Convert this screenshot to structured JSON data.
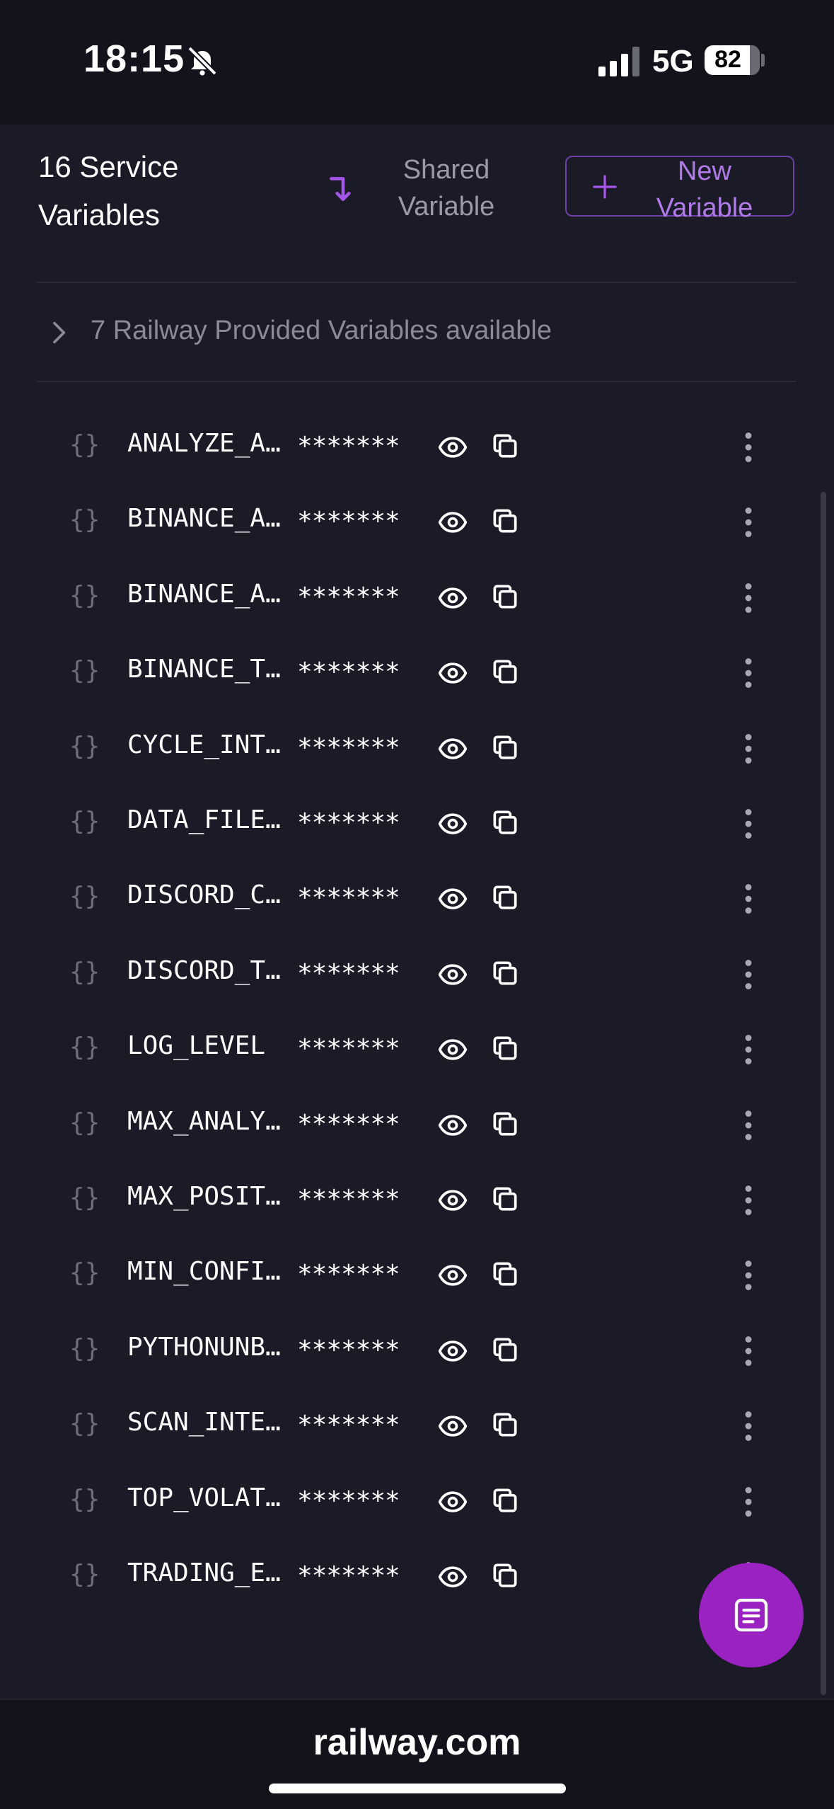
{
  "status_bar": {
    "time": "18:15",
    "network": "5G",
    "battery": "82"
  },
  "header": {
    "title_line1": "16 Service",
    "title_line2": "Variables",
    "shared_line1": "Shared",
    "shared_line2": "Variable",
    "new_line1": "New",
    "new_line2": "Variable"
  },
  "provided": {
    "text": "7 Railway Provided Variables available"
  },
  "variables": [
    {
      "name": "ANALYZE_A…",
      "value": "*******"
    },
    {
      "name": "BINANCE_A…",
      "value": "*******"
    },
    {
      "name": "BINANCE_A…",
      "value": "*******"
    },
    {
      "name": "BINANCE_T…",
      "value": "*******"
    },
    {
      "name": "CYCLE_INT…",
      "value": "*******"
    },
    {
      "name": "DATA_FILE…",
      "value": "*******"
    },
    {
      "name": "DISCORD_C…",
      "value": "*******"
    },
    {
      "name": "DISCORD_T…",
      "value": "*******"
    },
    {
      "name": "LOG_LEVEL",
      "value": "*******"
    },
    {
      "name": "MAX_ANALY…",
      "value": "*******"
    },
    {
      "name": "MAX_POSIT…",
      "value": "*******"
    },
    {
      "name": "MIN_CONFI…",
      "value": "*******"
    },
    {
      "name": "PYTHONUNB…",
      "value": "*******"
    },
    {
      "name": "SCAN_INTE…",
      "value": "*******"
    },
    {
      "name": "TOP_VOLAT…",
      "value": "*******"
    },
    {
      "name": "TRADING_E…",
      "value": "*******"
    }
  ],
  "icons": {
    "variable": "braces-icon",
    "reveal": "eye-icon",
    "copy": "copy-icon",
    "menu": "more-vertical-icon",
    "fab": "list-icon"
  },
  "colors": {
    "background": "#1b1a27",
    "accent": "#9a22c0",
    "accent_text": "#b07be8"
  },
  "footer": {
    "url": "railway.com"
  }
}
